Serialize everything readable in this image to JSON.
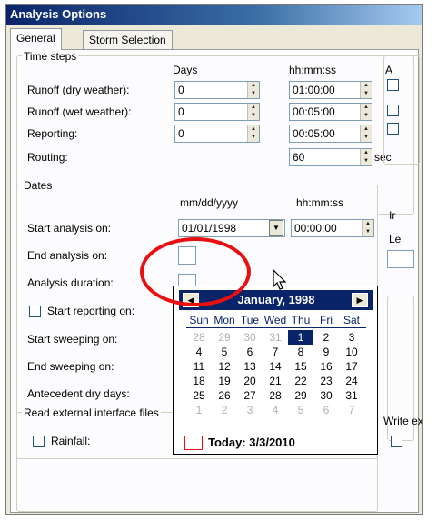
{
  "window": {
    "title": "Analysis Options"
  },
  "tabs": [
    {
      "label": "General",
      "active": true
    },
    {
      "label": "Storm Selection",
      "active": false
    }
  ],
  "time_steps": {
    "title": "Time steps",
    "col_days": "Days",
    "col_time": "hh:mm:ss",
    "rows": [
      {
        "label": "Runoff (dry weather):",
        "days": "0",
        "time": "01:00:00"
      },
      {
        "label": "Runoff (wet weather):",
        "days": "0",
        "time": "00:05:00"
      },
      {
        "label": "Reporting:",
        "days": "0",
        "time": "00:05:00"
      }
    ],
    "routing_label": "Routing:",
    "routing_value": "60",
    "routing_unit": "sec"
  },
  "dates": {
    "title": "Dates",
    "col_date": "mm/dd/yyyy",
    "col_time": "hh:mm:ss",
    "start_label": "Start analysis on:",
    "start_date": "01/01/1998",
    "start_time": "00:00:00",
    "end_label": "End analysis on:",
    "duration_label": "Analysis duration:",
    "start_reporting_label": "Start reporting on:",
    "start_sweeping_label": "Start sweeping on:",
    "end_sweeping_label": "End sweeping on:",
    "antecedent_label": "Antecedent dry days:"
  },
  "calendar": {
    "title": "January, 1998",
    "weekdays": [
      "Sun",
      "Mon",
      "Tue",
      "Wed",
      "Thu",
      "Fri",
      "Sat"
    ],
    "days": [
      [
        "28",
        "29",
        "30",
        "31",
        "1",
        "2",
        "3"
      ],
      [
        "4",
        "5",
        "6",
        "7",
        "8",
        "9",
        "10"
      ],
      [
        "11",
        "12",
        "13",
        "14",
        "15",
        "16",
        "17"
      ],
      [
        "18",
        "19",
        "20",
        "21",
        "22",
        "23",
        "24"
      ],
      [
        "25",
        "26",
        "27",
        "28",
        "29",
        "30",
        "31"
      ],
      [
        "1",
        "2",
        "3",
        "4",
        "5",
        "6",
        "7"
      ]
    ],
    "selected_day": "1",
    "today_label": "Today: 3/3/2010"
  },
  "interface_files": {
    "title": "Read external interface files",
    "rainfall_label": "Rainfall:"
  },
  "right_panel": {
    "letters": [
      "A",
      "Le",
      "Ir"
    ],
    "write_label": "Write ex"
  },
  "colors": {
    "titlebar": "#0a246a",
    "highlight_circle": "#e81010",
    "calendar_header": "#0a246a"
  }
}
